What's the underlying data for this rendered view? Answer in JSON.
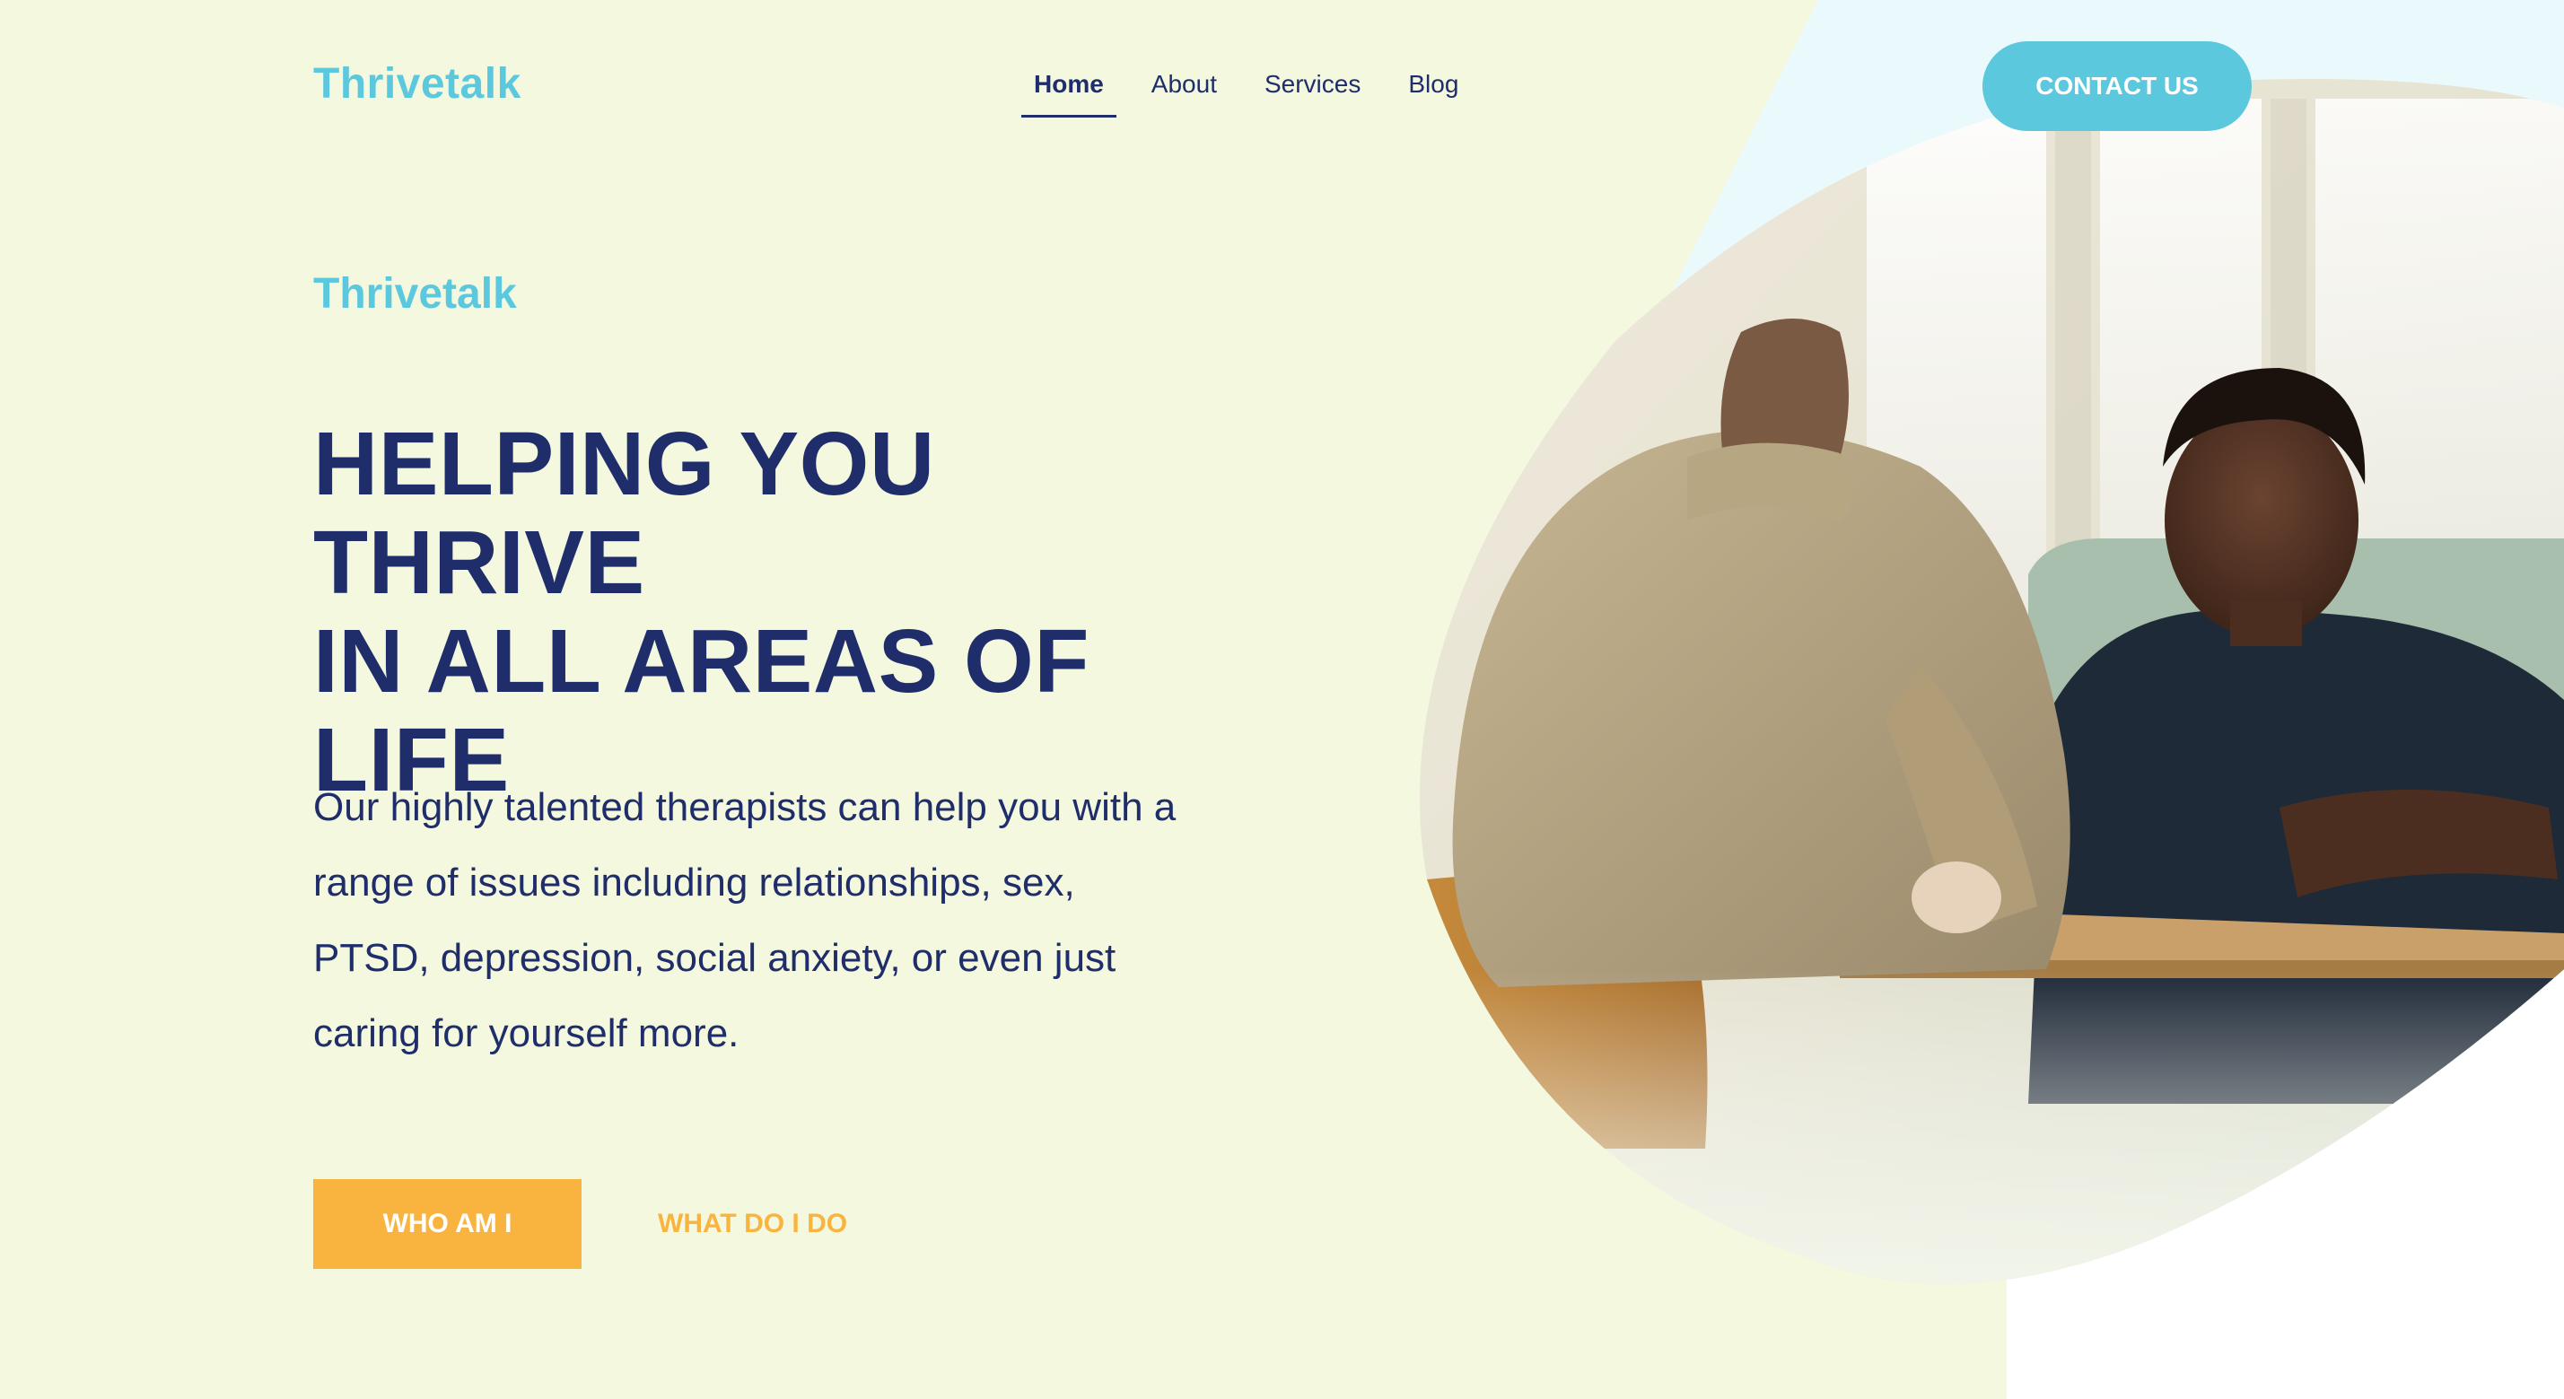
{
  "brand": {
    "logo": "Thrivetalk"
  },
  "nav": {
    "items": [
      {
        "label": "Home",
        "active": true
      },
      {
        "label": "About",
        "active": false
      },
      {
        "label": "Services",
        "active": false
      },
      {
        "label": "Blog",
        "active": false
      }
    ]
  },
  "header": {
    "contact_label": "CONTACT US"
  },
  "hero": {
    "eyebrow": "Thrivetalk",
    "headline_line1": "HELPING YOU THRIVE",
    "headline_line2": "IN ALL AREAS OF LIFE",
    "description": "Our highly talented therapists can help you with a range of issues including relationships, sex, PTSD, depression, social anxiety, or even just caring for yourself more.",
    "primary_button": "WHO AM I",
    "secondary_button": "WHAT DO I DO",
    "photo_icon": "therapy-session-photo"
  },
  "colors": {
    "cream_background": "#f3f8df",
    "light_blue_accent": "#eafafc",
    "brand_teal": "#5cc8de",
    "navy_text": "#1f2d6b",
    "orange_cta": "#f9b43f"
  }
}
